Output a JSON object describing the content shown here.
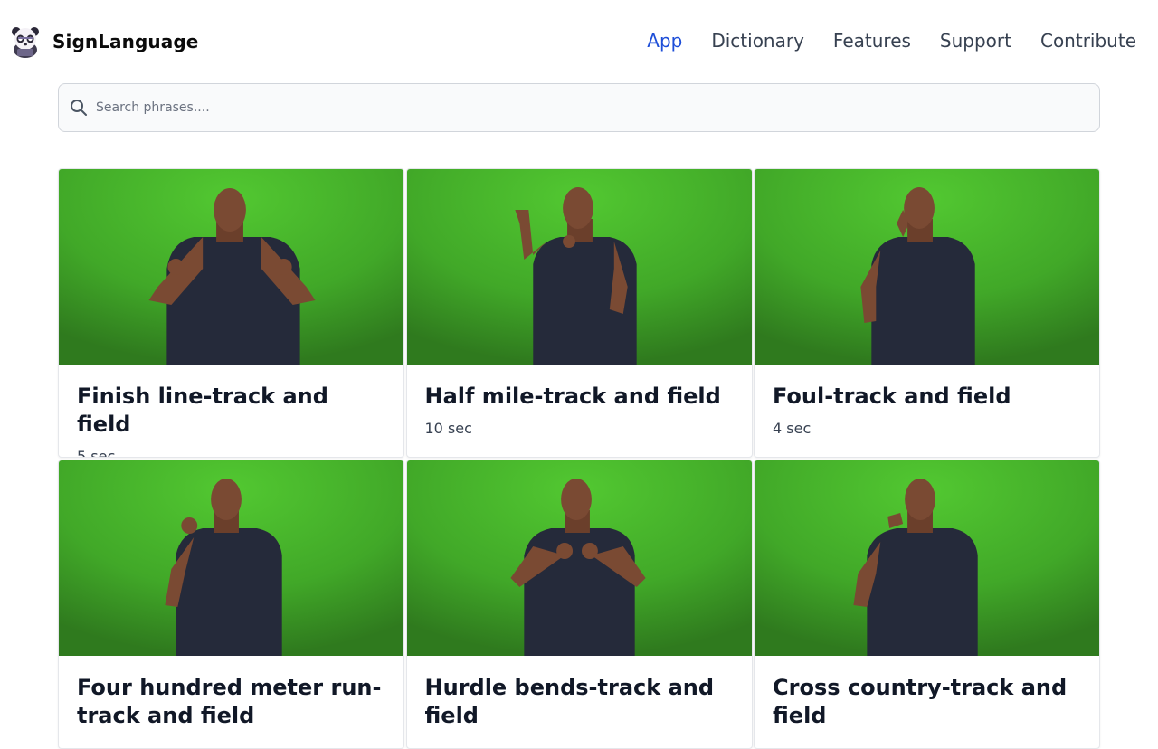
{
  "app": {
    "name": "SignLanguage"
  },
  "nav": [
    {
      "label": "App",
      "active": true
    },
    {
      "label": "Dictionary",
      "active": false
    },
    {
      "label": "Features",
      "active": false
    },
    {
      "label": "Support",
      "active": false
    },
    {
      "label": "Contribute",
      "active": false
    }
  ],
  "search": {
    "placeholder": "Search phrases....",
    "value": ""
  },
  "colors": {
    "accent": "#1d4ed8",
    "nav_text": "#374151",
    "green_screen": "#44b62a"
  },
  "cards": [
    {
      "title": "Finish line-track and field",
      "duration": "5 sec"
    },
    {
      "title": "Half mile-track and field",
      "duration": "10 sec"
    },
    {
      "title": "Foul-track and field",
      "duration": "4 sec"
    },
    {
      "title": "Four hundred meter run-track and field",
      "duration": ""
    },
    {
      "title": "Hurdle bends-track and field",
      "duration": ""
    },
    {
      "title": "Cross country-track and field",
      "duration": ""
    }
  ]
}
